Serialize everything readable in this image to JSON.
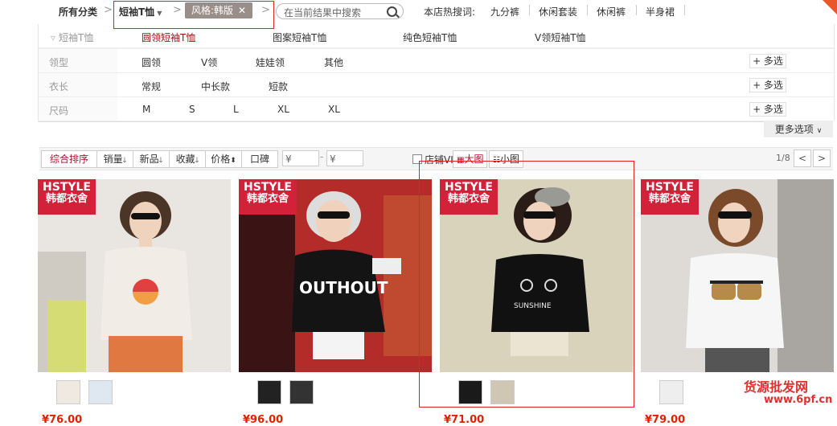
{
  "breadcrumb": {
    "all_categories": "所有分类",
    "category": "短袖T恤",
    "tag": "风格:韩版",
    "search_placeholder": "在当前结果中搜索",
    "hot_label": "本店热搜词:",
    "hot_words": [
      "九分裤",
      "休闲套装",
      "休闲裤",
      "半身裙"
    ]
  },
  "filters": {
    "category_label": "短袖T恤",
    "category_options": [
      "圆领短袖T恤",
      "图案短袖T恤",
      "纯色短袖T恤",
      "V领短袖T恤"
    ],
    "rows": [
      {
        "label": "领型",
        "options": [
          "圆领",
          "V领",
          "娃娃领",
          "其他"
        ],
        "more": "+ 多选"
      },
      {
        "label": "衣长",
        "options": [
          "常规",
          "中长款",
          "短款"
        ],
        "more": "+ 多选"
      },
      {
        "label": "尺码",
        "options": [
          "M",
          "S",
          "L",
          "XL",
          "XL"
        ],
        "more": "+ 多选"
      }
    ],
    "more_options": "更多选项"
  },
  "sortbar": {
    "sorts": [
      "综合排序",
      "销量",
      "新品",
      "收藏",
      "价格",
      "口碑"
    ],
    "price_from": "¥",
    "price_to": "¥",
    "vip": "店铺VIP商品",
    "view_big": "大图",
    "view_small": "小图",
    "page": "1/8",
    "prev": "<",
    "next": ">"
  },
  "products": [
    {
      "brand_en": "HSTYLE",
      "brand_cn": "韩都衣舍",
      "price": "¥76.00",
      "shirt_color": "#f1ede6"
    },
    {
      "brand_en": "HSTYLE",
      "brand_cn": "韩都衣舍",
      "price": "¥96.00",
      "shirt_color": "#141414"
    },
    {
      "brand_en": "HSTYLE",
      "brand_cn": "韩都衣舍",
      "price": "¥71.00",
      "shirt_color": "#111111"
    },
    {
      "brand_en": "HSTYLE",
      "brand_cn": "韩都衣舍",
      "price": "¥79.00",
      "shirt_color": "#f6f6f6"
    }
  ],
  "watermark": {
    "text": "货源批发网",
    "url": "www.6pf.cn"
  },
  "colors": {
    "accent_red": "#d4213a",
    "price_red": "#dd2200"
  }
}
